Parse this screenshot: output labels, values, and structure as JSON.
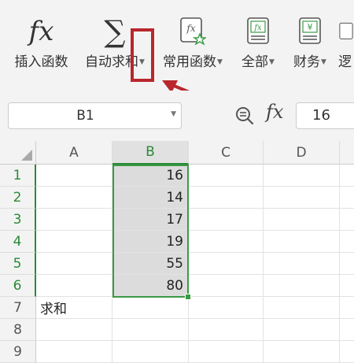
{
  "ribbon": {
    "buttons": [
      {
        "label": "插入函数",
        "icon": "fx-icon",
        "has_caret": false
      },
      {
        "label": "自动求和",
        "icon": "sigma-icon",
        "has_caret": true
      },
      {
        "label": "常用函数",
        "icon": "star-function-icon",
        "has_caret": true
      },
      {
        "label": "全部",
        "icon": "function-book-icon",
        "has_caret": true
      },
      {
        "label": "财务",
        "icon": "yen-book-icon",
        "has_caret": true
      },
      {
        "label": "逻",
        "icon": "logic-book-icon",
        "has_caret": false
      }
    ]
  },
  "formula_bar": {
    "name_box": "B1",
    "fx_symbol": "fx",
    "value": "16"
  },
  "grid": {
    "columns": [
      "A",
      "B",
      "C",
      "D"
    ],
    "rows": [
      "1",
      "2",
      "3",
      "4",
      "5",
      "6",
      "7",
      "8",
      "9"
    ],
    "b_values": [
      "16",
      "14",
      "17",
      "19",
      "55",
      "80"
    ],
    "a7": "求和"
  },
  "colors": {
    "selection": "#3b9a45",
    "highlight_box": "#b8272d"
  }
}
